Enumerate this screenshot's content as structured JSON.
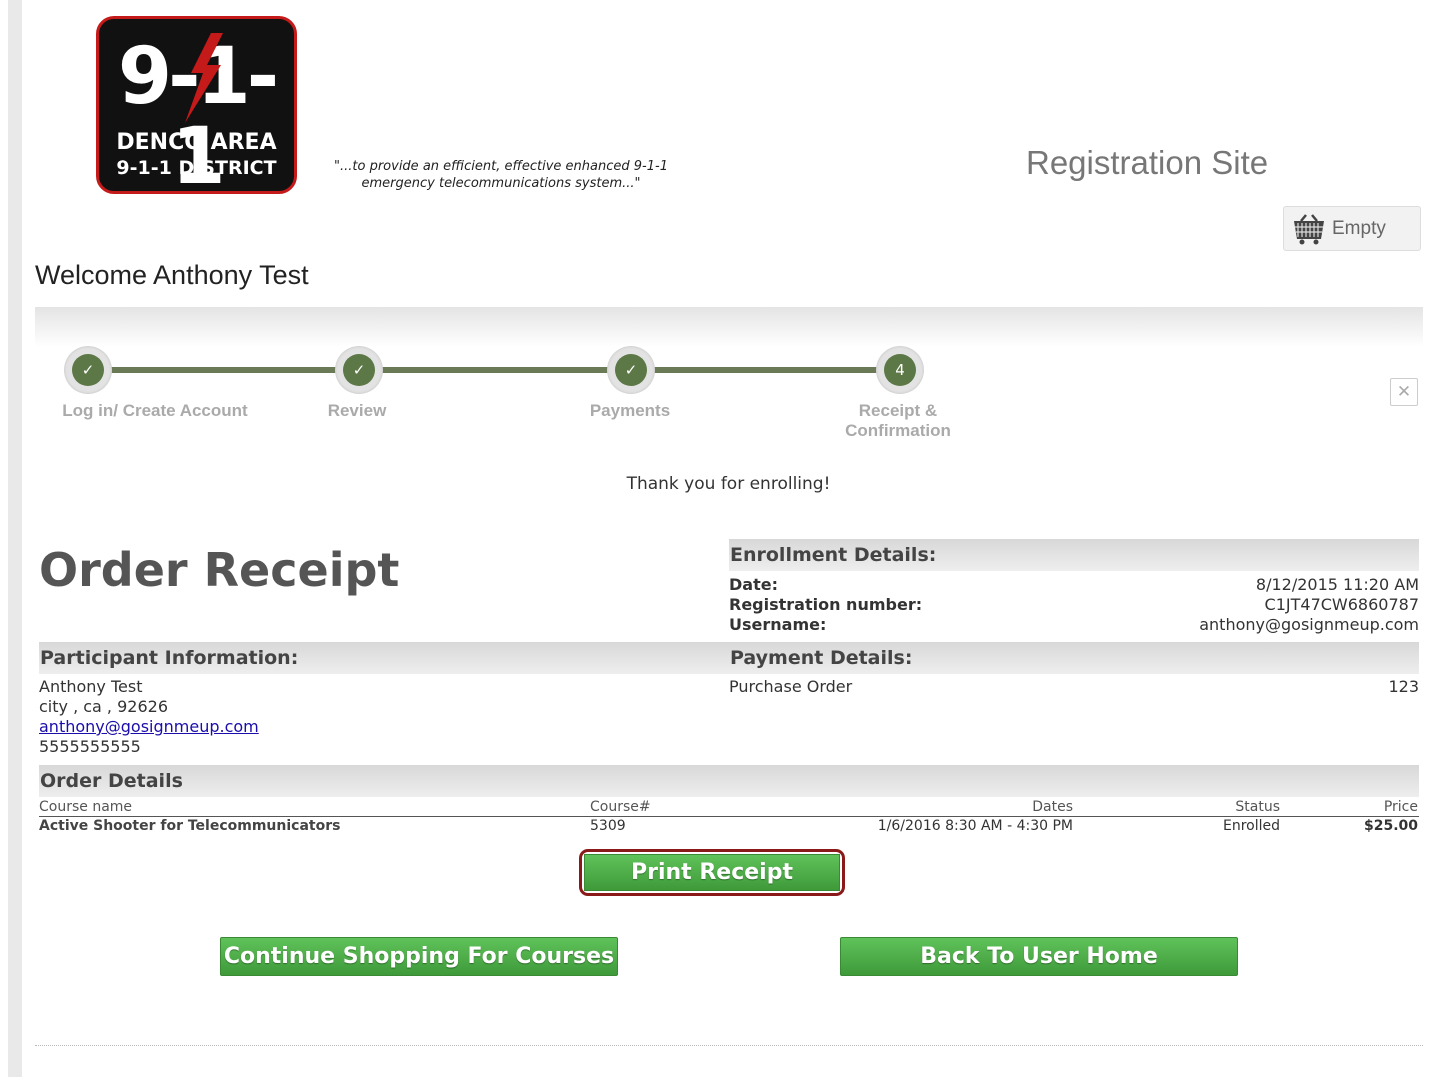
{
  "header": {
    "logo": {
      "number": "9-1-1",
      "line1": "DENCO AREA",
      "line2": "9-1-1 DISTRICT"
    },
    "tagline_line1": "\"...to provide an efficient, effective enhanced 9-1-1",
    "tagline_line2": "emergency telecommunications system...\"",
    "site_title": "Registration Site",
    "cart": {
      "icon": "shopping-basket-icon",
      "label": "Empty"
    }
  },
  "welcome": "Welcome Anthony Test",
  "wizard": {
    "steps": [
      {
        "label": "Log in/ Create Account",
        "marker": "✓",
        "state": "done"
      },
      {
        "label": "Review",
        "marker": "✓",
        "state": "done"
      },
      {
        "label": "Payments",
        "marker": "✓",
        "state": "done"
      },
      {
        "label_line1": "Receipt &",
        "label_line2": "Confirmation",
        "marker": "4",
        "state": "current"
      }
    ],
    "close_icon": "✕"
  },
  "thank_you": "Thank you for enrolling!",
  "receipt": {
    "title": "Order Receipt",
    "enrollment": {
      "header": "Enrollment Details:",
      "date_label": "Date:",
      "date_value": "8/12/2015 11:20 AM",
      "regnum_label": "Registration number:",
      "regnum_value": "C1JT47CW6860787",
      "username_label": "Username:",
      "username_value": "anthony@gosignmeup.com"
    },
    "participant": {
      "header": "Participant Information:",
      "name": "Anthony Test",
      "address": "city , ca , 92626",
      "email": "anthony@gosignmeup.com",
      "phone": "5555555555"
    },
    "payment": {
      "header": "Payment Details:",
      "method": "Purchase Order",
      "value": "123"
    },
    "order": {
      "header": "Order Details",
      "columns": [
        "Course name",
        "Course#",
        "Dates",
        "Status",
        "Price"
      ],
      "rows": [
        [
          "Active Shooter for Telecommunicators",
          "5309",
          "1/6/2016 8:30 AM - 4:30 PM",
          "Enrolled",
          "$25.00"
        ]
      ]
    }
  },
  "buttons": {
    "print": "Print Receipt",
    "continue": "Continue Shopping For Courses",
    "home": "Back To User Home"
  },
  "colors": {
    "accent_green": "#4caf47",
    "step_green": "#5c7846",
    "highlight_red": "#8a1a1a",
    "logo_red": "#c41a1a"
  }
}
